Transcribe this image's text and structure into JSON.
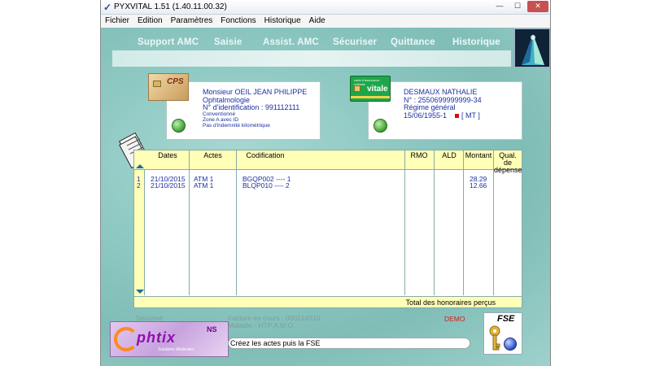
{
  "window": {
    "title": "PYXVITAL 1.51 (1.40.11.00.32)"
  },
  "menu": [
    "Fichier",
    "Edition",
    "Paramètres",
    "Fonctions",
    "Historique",
    "Aide"
  ],
  "nav_tabs": [
    "Support AMC",
    "Saisie",
    "Assist. AMC",
    "Sécuriser",
    "Quittance",
    "Historique"
  ],
  "practitioner": {
    "logo_text": "CPS",
    "name": "Monsieur OEIL JEAN PHILIPPE",
    "specialty": "Ophtalmologie",
    "id_line": "N° d'identification :  991112111",
    "notes": [
      "Conventionné",
      "Zone A avec ID",
      "Pas d'indemnité kilométrique"
    ]
  },
  "patient": {
    "logo_text": "vitale",
    "logo_small": "carte d'assurance maladie",
    "name": "DESMAUX NATHALIE",
    "number": "N° : 2550699999999-34",
    "regime": "Régime général",
    "birth": "15/06/1955-1",
    "tag": "[ MT ]"
  },
  "table": {
    "columns": [
      "Dates",
      "Actes",
      "Codification",
      "RMO",
      "ALD",
      "Montant",
      "Qual. de dépense"
    ],
    "rows": [
      {
        "index": "1",
        "date": "21/10/2015",
        "acte": "ATM 1",
        "code": "BGQP002 ---- 1",
        "rmo": "",
        "ald": "",
        "montant": "28.29",
        "qual": ""
      },
      {
        "index": "2",
        "date": "21/10/2015",
        "acte": "ATM 1",
        "code": "BLQP010 ---- 2",
        "rmo": "",
        "ald": "",
        "montant": "12.66",
        "qual": ""
      }
    ],
    "total_label": "Total des honoraires perçus"
  },
  "status": {
    "secure": "Sécurisé",
    "invoice": "Facture en cours : 000124510",
    "insurance": "Maladie - HTP A.M.O.",
    "demo": "DEMO",
    "message": "Créez les actes puis la FSE",
    "fse_label": "FSE"
  },
  "branding": {
    "ophtix": "phtix",
    "ns": "NS",
    "sub": "Solutions Médicales"
  },
  "colors": {
    "background": "#8fc9c3",
    "table_header": "#ffffb8",
    "data_text": "#1b2fa0",
    "demo": "#d42020"
  }
}
